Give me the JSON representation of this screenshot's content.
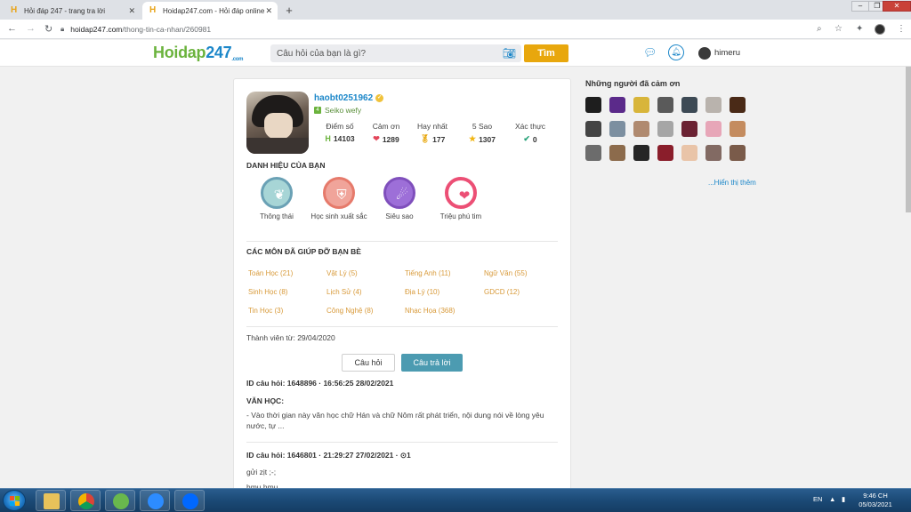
{
  "browser": {
    "tabs": [
      {
        "title": "Hỏi đáp 247 - trang tra lời",
        "active": false
      },
      {
        "title": "Hoidap247.com - Hỏi đáp online",
        "active": true
      }
    ],
    "url_host": "hoidap247.com",
    "url_path": "/thong-tin-ca-nhan/260981"
  },
  "header": {
    "logo_main": "Hoidap",
    "logo_num": "247",
    "logo_suffix": ".com",
    "search_placeholder": "Câu hỏi của bạn là gì?",
    "search_button": "Tìm",
    "user_name": "himeru"
  },
  "profile": {
    "username": "haobt0251962",
    "rank": "Seiko wefy",
    "stats": [
      {
        "label": "Điểm số",
        "value": "14103",
        "icon": "points-icon"
      },
      {
        "label": "Cảm ơn",
        "value": "1289",
        "icon": "heart-icon"
      },
      {
        "label": "Hay nhất",
        "value": "177",
        "icon": "medal-icon"
      },
      {
        "label": "5 Sao",
        "value": "1307",
        "icon": "star-icon"
      },
      {
        "label": "Xác thực",
        "value": "0",
        "icon": "check-icon"
      }
    ]
  },
  "titles": {
    "heading": "DANH HIỆU CỦA BẠN",
    "items": [
      {
        "label": "Thông thái",
        "icon": "wheat-icon"
      },
      {
        "label": "Học sinh xuất sắc",
        "icon": "shield-icon"
      },
      {
        "label": "Siêu sao",
        "icon": "comet-icon"
      },
      {
        "label": "Triệu phú tim",
        "icon": "heart-icon"
      }
    ]
  },
  "subjects": {
    "heading": "CÁC MÔN ĐÃ GIÚP ĐỠ BẠN BÈ",
    "items": [
      "Toán Học (21)",
      "Vật Lý (5)",
      "Tiếng Anh (11)",
      "Ngữ Văn (55)",
      "Sinh Học (8)",
      "Lịch Sử (4)",
      "Địa Lý (10)",
      "GDCD (12)",
      "Tin Học (3)",
      "Công Nghệ (8)",
      "Nhạc Họa (368)"
    ]
  },
  "member_since": "Thành viên từ: 29/04/2020",
  "tabs": {
    "questions": "Câu hỏi",
    "answers": "Câu trả lời"
  },
  "answers": [
    {
      "id_line": "ID câu hỏi: 1648896 · 16:56:25 28/02/2021",
      "subject": "VĂN HỌC:",
      "text": "- Vào thời gian này văn học chữ Hán và chữ Nôm rất phát triển, nội dung nói về lòng yêu nước, tự ..."
    },
    {
      "id_line": "ID câu hỏi: 1646801 · 21:29:27 27/02/2021 · ⊙1",
      "text1": "gửi zịt ;-;",
      "text2": "hmu hmu"
    }
  ],
  "thanks": {
    "title": "Những người đã cảm ơn",
    "more": "...Hiển thị thêm",
    "avatar_colors": [
      "#1e1e1e",
      "#5b2a8a",
      "#d8b53a",
      "#5a5a5a",
      "#3d4a55",
      "#b9b3ad",
      "#4a2a17",
      "#444444",
      "#7c8fa0",
      "#b08a6f",
      "#a6a6a6",
      "#6b2233",
      "#e7a6b8",
      "#c48c5f",
      "#6c6c6c",
      "#8c6b4c",
      "#262626",
      "#8a1e2b",
      "#e9c4a8",
      "#826a63",
      "#7a5b4a"
    ]
  },
  "taskbar": {
    "lang": "EN",
    "time": "9:46 CH",
    "date": "05/03/2021"
  }
}
